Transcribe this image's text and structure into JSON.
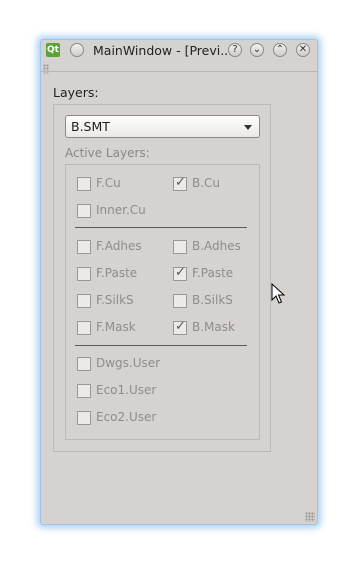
{
  "window": {
    "title": "MainWindow - [Previ...",
    "app_icon_text": "Qt",
    "buttons": [
      "?",
      "⌄",
      "⌃",
      "✕"
    ]
  },
  "layers_label": "Layers:",
  "combo": {
    "value": "B.SMT"
  },
  "active_layers_label": "Active Layers:",
  "layers": [
    {
      "name": "F.Cu",
      "checked": false
    },
    {
      "name": "B.Cu",
      "checked": true
    },
    {
      "name": "Inner.Cu",
      "checked": false
    },
    {
      "name": "F.Adhes",
      "checked": false
    },
    {
      "name": "B.Adhes",
      "checked": false
    },
    {
      "name": "F.Paste",
      "checked": false
    },
    {
      "name": "F.Paste",
      "checked": true
    },
    {
      "name": "F.SilkS",
      "checked": false
    },
    {
      "name": "B.SilkS",
      "checked": false
    },
    {
      "name": "F.Mask",
      "checked": false
    },
    {
      "name": "B.Mask",
      "checked": true
    },
    {
      "name": "Dwgs.User",
      "checked": false
    },
    {
      "name": "Eco1.User",
      "checked": false
    },
    {
      "name": "Eco2.User",
      "checked": false
    }
  ],
  "colors": {
    "window_bg": "#d6d2d0",
    "glow": "#64aaeb",
    "disabled_text": "#8f8c89"
  }
}
